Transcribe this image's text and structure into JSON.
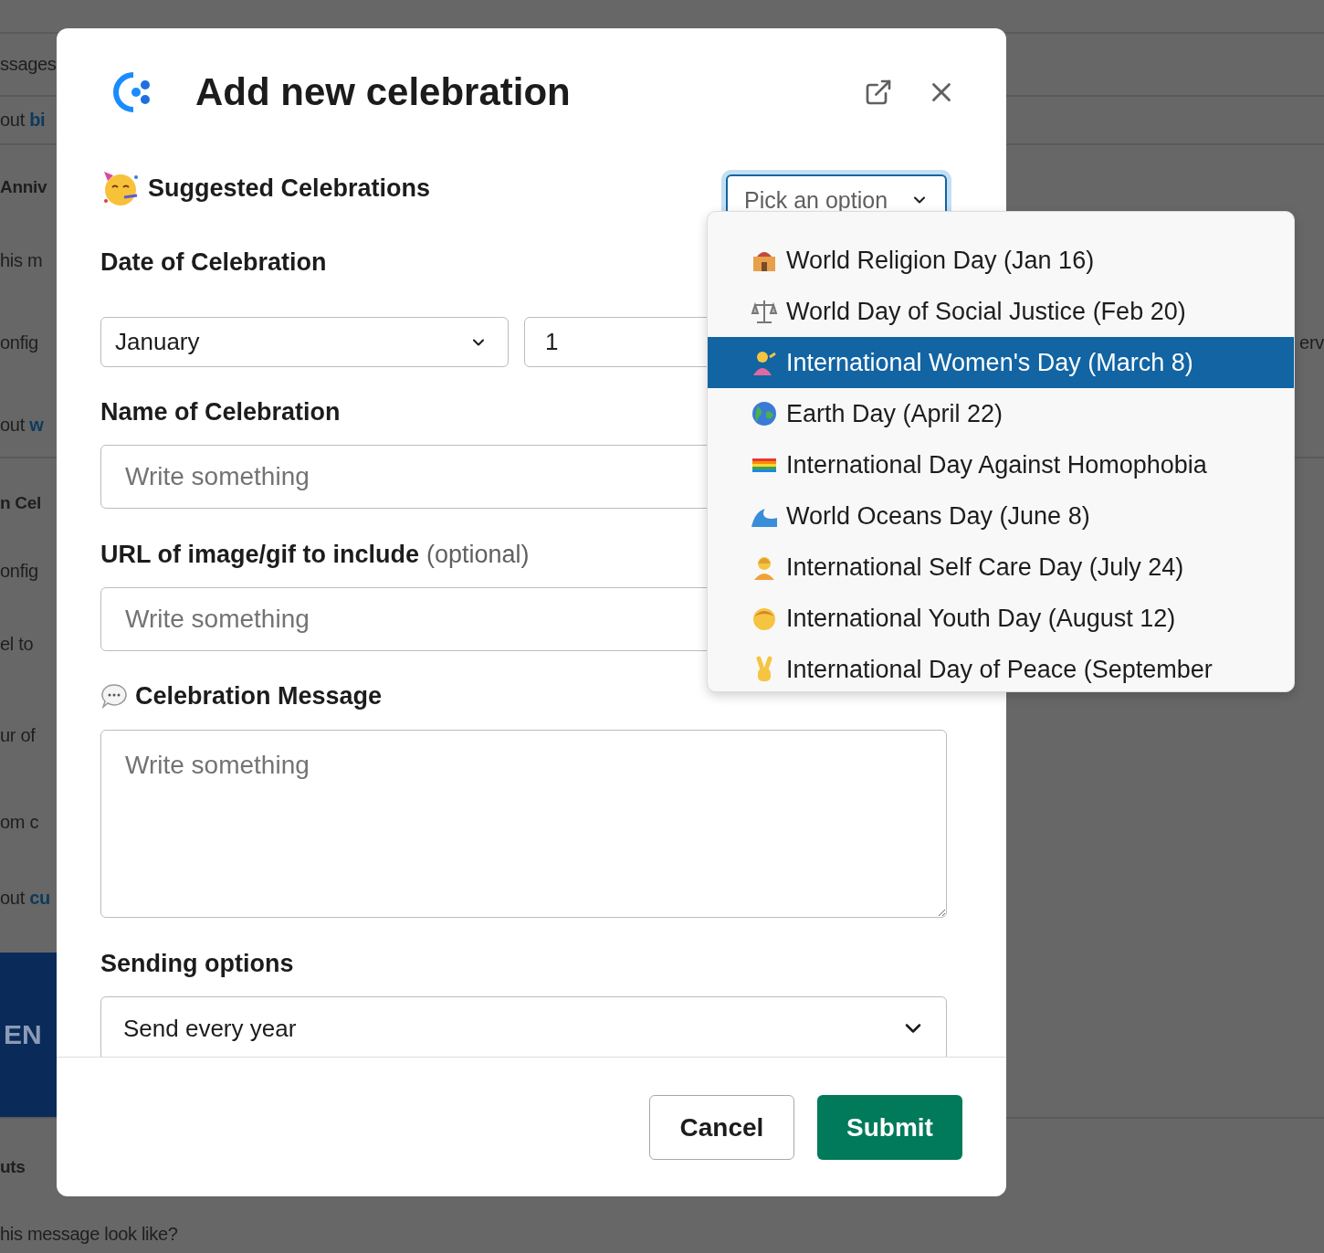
{
  "background": [
    {
      "kind": "text",
      "text": "ssages"
    },
    {
      "kind": "link",
      "text": "out",
      "link": "bi"
    },
    {
      "kind": "heading",
      "text": "Anniv"
    },
    {
      "kind": "text",
      "text": "his m"
    },
    {
      "kind": "text",
      "text": "onfig",
      "aside": "erv"
    },
    {
      "kind": "link",
      "text": "out",
      "link": "w"
    },
    {
      "kind": "heading",
      "text": "n Cel"
    },
    {
      "kind": "text",
      "text": "onfig"
    },
    {
      "kind": "text",
      "text": "el to"
    },
    {
      "kind": "text",
      "text": "ur of"
    },
    {
      "kind": "text",
      "text": "om c"
    },
    {
      "kind": "link",
      "text": "out",
      "link": "cu"
    },
    {
      "kind": "banner",
      "text": "EN"
    },
    {
      "kind": "heading",
      "text": "uts"
    },
    {
      "kind": "text",
      "text": "his message look like?"
    }
  ],
  "modal": {
    "title": "Add new celebration",
    "suggested": {
      "label": "Suggested Celebrations",
      "placeholder": "Pick an option",
      "options": [
        {
          "label": "World Religion Day (Jan 16)",
          "selected": false
        },
        {
          "label": "World Day of Social Justice (Feb 20)",
          "selected": false
        },
        {
          "label": "International Women's Day (March 8)",
          "selected": true
        },
        {
          "label": "Earth Day (April 22)",
          "selected": false
        },
        {
          "label": "International Day Against Homophobia",
          "selected": false
        },
        {
          "label": "World Oceans Day (June 8)",
          "selected": false
        },
        {
          "label": "International Self Care Day (July 24)",
          "selected": false
        },
        {
          "label": "International Youth Day (August 12)",
          "selected": false
        },
        {
          "label": "International Day of Peace (September",
          "selected": false
        }
      ]
    },
    "date": {
      "label": "Date of Celebration",
      "month": "January",
      "day": "1"
    },
    "name": {
      "label": "Name of Celebration",
      "placeholder": "Write something"
    },
    "url": {
      "label": "URL of image/gif to include",
      "note": "(optional)",
      "placeholder": "Write something"
    },
    "message": {
      "label": "Celebration Message",
      "placeholder": "Write something"
    },
    "sending": {
      "label": "Sending options",
      "value": "Send every year"
    },
    "buttons": [
      {
        "kind": "secondary",
        "label": "Cancel"
      },
      {
        "kind": "primary",
        "label": "Submit"
      }
    ]
  }
}
